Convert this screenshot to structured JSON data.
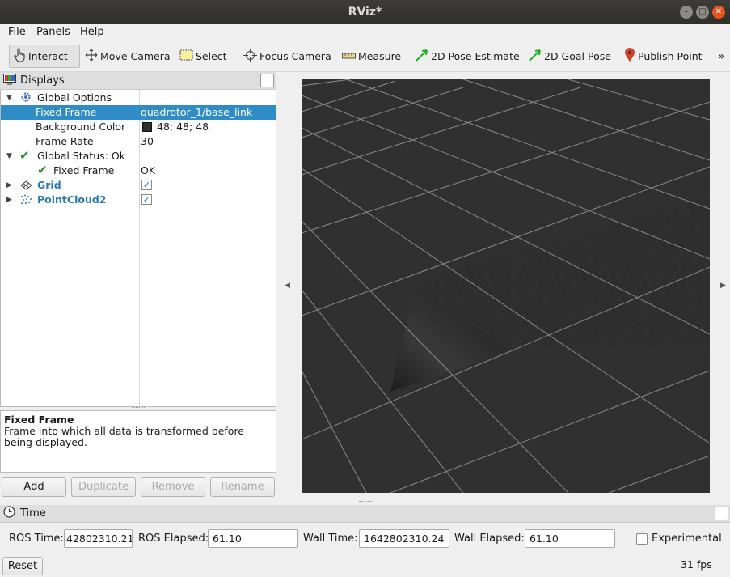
{
  "window": {
    "title": "RViz*"
  },
  "menu": [
    "File",
    "Panels",
    "Help"
  ],
  "toolbar": [
    {
      "label": "Interact",
      "icon": "hand-pointer-icon"
    },
    {
      "label": "Move Camera",
      "icon": "move-arrows-icon"
    },
    {
      "label": "Select",
      "icon": "select-rect-icon"
    },
    {
      "label": "Focus Camera",
      "icon": "crosshair-icon"
    },
    {
      "label": "Measure",
      "icon": "ruler-icon"
    },
    {
      "label": "2D Pose Estimate",
      "icon": "green-arrow-icon"
    },
    {
      "label": "2D Goal Pose",
      "icon": "green-arrow-icon"
    },
    {
      "label": "Publish Point",
      "icon": "map-pin-icon"
    }
  ],
  "toolbar_overflow": "»",
  "displays": {
    "title": "Displays",
    "rows": [
      {
        "label": "Global Options",
        "value": ""
      },
      {
        "label": "Fixed Frame",
        "value": "quadrotor_1/base_link"
      },
      {
        "label": "Background Color",
        "value": "48; 48; 48"
      },
      {
        "label": "Frame Rate",
        "value": "30"
      },
      {
        "label": "Global Status: Ok",
        "value": ""
      },
      {
        "label": "Fixed Frame",
        "value": "OK"
      },
      {
        "label": "Grid",
        "value": "✓"
      },
      {
        "label": "PointCloud2",
        "value": "✓"
      }
    ],
    "bg_color_swatch": "#303030",
    "description_title": "Fixed Frame",
    "description_text": "Frame into which all data is transformed before being displayed."
  },
  "buttons": {
    "add": "Add",
    "duplicate": "Duplicate",
    "remove": "Remove",
    "rename": "Rename"
  },
  "time": {
    "title": "Time",
    "ros_time_label": "ROS Time:",
    "ros_time": "42802310.21",
    "ros_elapsed_label": "ROS Elapsed:",
    "ros_elapsed": "61.10",
    "wall_time_label": "Wall Time:",
    "wall_time": "1642802310.24",
    "wall_elapsed_label": "Wall Elapsed:",
    "wall_elapsed": "61.10",
    "experimental_label": "Experimental",
    "reset_label": "Reset",
    "fps": "31 fps"
  },
  "colors": {
    "selection": "#308cc6",
    "viewport_bg": "#303030",
    "accent_blue": "#2a7ab8"
  }
}
